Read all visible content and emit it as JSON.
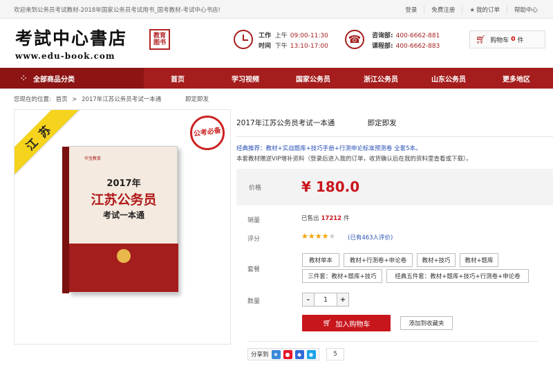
{
  "topbar": {
    "welcome": "欢迎来到公务员考试教材-2018年国家公务员考试用书_国考教材-考试中心书店!",
    "login": "登录",
    "register": "免费注册",
    "my_orders": "我的订单",
    "help": "帮助中心"
  },
  "header": {
    "logo_cn": "考試中心書店",
    "logo_en": "www.edu-book.com",
    "seal_text": "教育图书",
    "hours_label": "工作",
    "hours_am_label": "上午",
    "hours_am": "09:00-11:30",
    "time_label": "时间",
    "hours_pm_label": "下午",
    "hours_pm": "13:10-17:00",
    "consult_label": "咨询部:",
    "consult_phone": "400-6662-881",
    "course_label": "课程部:",
    "course_phone": "400-6662-883",
    "cart_label": "购物车",
    "cart_count": "0",
    "cart_unit": "件"
  },
  "nav": {
    "category": "全部商品分类",
    "items": [
      "首页",
      "学习视频",
      "国家公务员",
      "浙江公务员",
      "山东公务员",
      "更多地区"
    ]
  },
  "breadcrumb": {
    "prefix": "您现在的位置:",
    "home": "首页",
    "sep": ">",
    "current": "2017年江苏公务员考试一本通",
    "status": "即定即发"
  },
  "image": {
    "ribbon": "江苏",
    "stamp": "公考必备",
    "book_brand": "华宝教育",
    "book_year": "2017年",
    "book_title": "江苏公务员",
    "book_subtitle": "考试一本通"
  },
  "product": {
    "title": "2017年江苏公务员考试一本通",
    "badge": "即定即发",
    "promo": "经典推荐：教材+实战题库+技巧手册+行测申论标准预测卷 全套5本。",
    "note": "本套教材赠送VIP增补资料（登录后进入我的订单，收货确认后在我的资料里查看或下载）。",
    "price_label": "价格",
    "price": "¥ 180.0",
    "sales_label": "销量",
    "sales_prefix": "已售出",
    "sales_count": "17212",
    "sales_unit": "件",
    "rating_label": "评分",
    "rating": 4,
    "rating_max": 5,
    "reviews": "(已有463人评价)",
    "package_label": "套餐",
    "packages": [
      "教材单本",
      "教材+行测卷+申论卷",
      "教材+技巧",
      "教材+题库",
      "三件套：教材+题库+技巧",
      "经典五件套：教材+题库+技巧+行测卷+申论卷"
    ],
    "qty_label": "数量",
    "qty": "1",
    "minus": "-",
    "plus": "+",
    "add_to_cart": "加入购物车",
    "favorite": "添加到收藏夹",
    "share_label": "分享到",
    "share_count": "5"
  },
  "colors": {
    "brand": "#a51d1d",
    "price": "#c8161d",
    "link": "#2850b5",
    "ribbon": "#f6d31c"
  }
}
